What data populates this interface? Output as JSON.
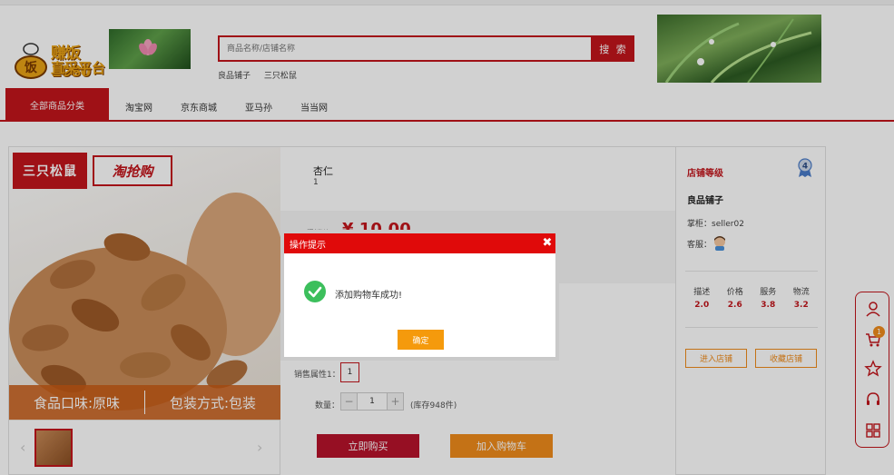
{
  "header": {
    "logo_line1": "赚饭1080",
    "logo_line2": "直采平台",
    "search_placeholder": "商品名称/店铺名称",
    "search_button": "搜 索",
    "hot_words": [
      "良品铺子",
      "三只松鼠"
    ]
  },
  "nav": {
    "all_categories": "全部商品分类",
    "links": [
      "淘宝网",
      "京东商城",
      "亚马孙",
      "当当网"
    ]
  },
  "gallery": {
    "brand_name": "三只松鼠",
    "brand_slogan": "淘抢购",
    "bottom_left": "食品口味:原味",
    "bottom_right": "包装方式:包装",
    "prev": "‹",
    "next": "›"
  },
  "product": {
    "name": "杏仁",
    "subtitle": "1",
    "price_label": "促销价：",
    "price": "¥ 10.00",
    "attr_label": "销售属性1：",
    "attr_value": "1",
    "qty_label": "数量：",
    "qty_value": "1",
    "minus": "−",
    "plus": "+",
    "stock": "(库存948件)",
    "buy_now": "立即购买",
    "add_to_cart": "加入购物车"
  },
  "shop": {
    "level_label": "店铺等级",
    "level": "4",
    "name": "良品铺子",
    "keeper": "掌柜：seller02",
    "service_label": "客服：",
    "scores": [
      {
        "label": "描述",
        "value": "2.0"
      },
      {
        "label": "价格",
        "value": "2.6"
      },
      {
        "label": "服务",
        "value": "3.8"
      },
      {
        "label": "物流",
        "value": "3.2"
      }
    ],
    "enter_shop": "进入店铺",
    "favorite_shop": "收藏店铺"
  },
  "sidebar": {
    "cart_count": "1"
  },
  "dialog": {
    "title": "操作提示",
    "close": "✖",
    "message": "添加购物车成功!",
    "ok": "确定"
  },
  "colors": {
    "brand_red": "#c2151b",
    "dialog_red": "#e00a0a",
    "orange": "#f08c1c",
    "success_green": "#3cbf5c"
  }
}
